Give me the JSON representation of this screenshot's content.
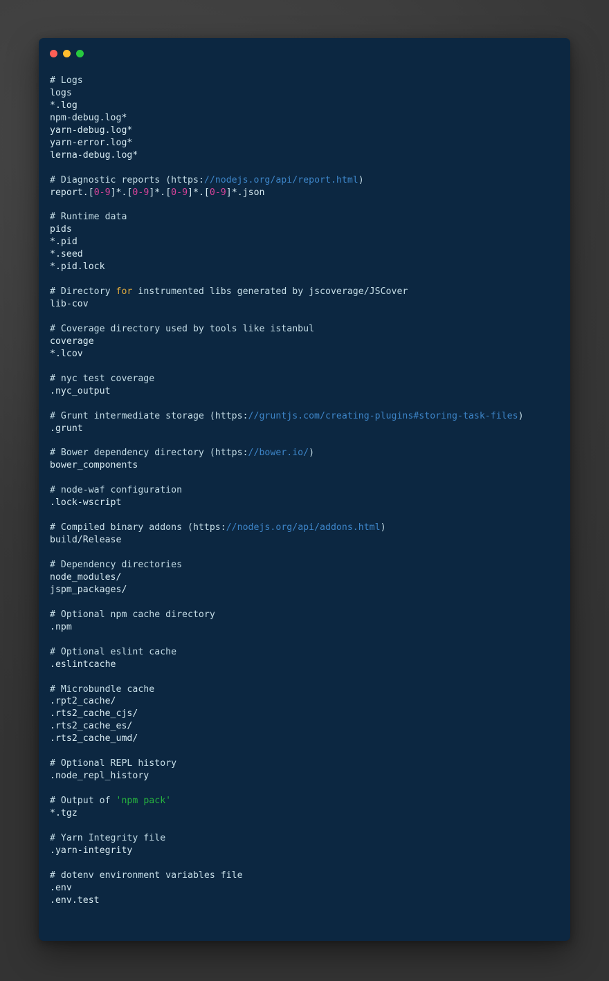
{
  "window": {
    "title": "",
    "background_color": "#0c2741",
    "page_background_color": "#3a3a3a",
    "traffic_lights": [
      {
        "name": "close",
        "color": "#ff5f56"
      },
      {
        "name": "minimize",
        "color": "#ffbd2e"
      },
      {
        "name": "zoom",
        "color": "#27c93f"
      }
    ]
  },
  "theme": {
    "text_color": "#d6e9f0",
    "comment_color": "#c5dde6",
    "url_color": "#3d85c8",
    "number_color": "#d9439a",
    "keyword_color": "#e0aa3e",
    "string_color": "#27b33f"
  },
  "code": {
    "language": "gitignore",
    "lines": [
      [
        {
          "t": "# Logs",
          "c": "cm"
        }
      ],
      [
        {
          "t": "logs",
          "c": "pl"
        }
      ],
      [
        {
          "t": "*.log",
          "c": "pl"
        }
      ],
      [
        {
          "t": "npm-debug.log*",
          "c": "pl"
        }
      ],
      [
        {
          "t": "yarn-debug.log*",
          "c": "pl"
        }
      ],
      [
        {
          "t": "yarn-error.log*",
          "c": "pl"
        }
      ],
      [
        {
          "t": "lerna-debug.log*",
          "c": "pl"
        }
      ],
      [],
      [
        {
          "t": "# Diagnostic reports (https:",
          "c": "cm"
        },
        {
          "t": "//nodejs.org/api/report.html",
          "c": "url"
        },
        {
          "t": ")",
          "c": "cm"
        }
      ],
      [
        {
          "t": "report.[",
          "c": "pl"
        },
        {
          "t": "0-9",
          "c": "num"
        },
        {
          "t": "]*.[",
          "c": "pl"
        },
        {
          "t": "0-9",
          "c": "num"
        },
        {
          "t": "]*.[",
          "c": "pl"
        },
        {
          "t": "0-9",
          "c": "num"
        },
        {
          "t": "]*.[",
          "c": "pl"
        },
        {
          "t": "0-9",
          "c": "num"
        },
        {
          "t": "]*.json",
          "c": "pl"
        }
      ],
      [],
      [
        {
          "t": "# Runtime data",
          "c": "cm"
        }
      ],
      [
        {
          "t": "pids",
          "c": "pl"
        }
      ],
      [
        {
          "t": "*.pid",
          "c": "pl"
        }
      ],
      [
        {
          "t": "*.seed",
          "c": "pl"
        }
      ],
      [
        {
          "t": "*.pid.lock",
          "c": "pl"
        }
      ],
      [],
      [
        {
          "t": "# Directory ",
          "c": "cm"
        },
        {
          "t": "for",
          "c": "kw"
        },
        {
          "t": " instrumented libs generated by jscoverage/JSCover",
          "c": "cm"
        }
      ],
      [
        {
          "t": "lib-cov",
          "c": "pl"
        }
      ],
      [],
      [
        {
          "t": "# Coverage directory used by tools like istanbul",
          "c": "cm"
        }
      ],
      [
        {
          "t": "coverage",
          "c": "pl"
        }
      ],
      [
        {
          "t": "*.lcov",
          "c": "pl"
        }
      ],
      [],
      [
        {
          "t": "# nyc test coverage",
          "c": "cm"
        }
      ],
      [
        {
          "t": ".nyc_output",
          "c": "pl"
        }
      ],
      [],
      [
        {
          "t": "# Grunt intermediate storage (https:",
          "c": "cm"
        },
        {
          "t": "//gruntjs.com/creating-plugins#storing-task-files",
          "c": "url"
        },
        {
          "t": ")",
          "c": "cm"
        }
      ],
      [
        {
          "t": ".grunt",
          "c": "pl"
        }
      ],
      [],
      [
        {
          "t": "# Bower dependency directory (https:",
          "c": "cm"
        },
        {
          "t": "//bower.io/",
          "c": "url"
        },
        {
          "t": ")",
          "c": "cm"
        }
      ],
      [
        {
          "t": "bower_components",
          "c": "pl"
        }
      ],
      [],
      [
        {
          "t": "# node-waf configuration",
          "c": "cm"
        }
      ],
      [
        {
          "t": ".lock-wscript",
          "c": "pl"
        }
      ],
      [],
      [
        {
          "t": "# Compiled binary addons (https:",
          "c": "cm"
        },
        {
          "t": "//nodejs.org/api/addons.html",
          "c": "url"
        },
        {
          "t": ")",
          "c": "cm"
        }
      ],
      [
        {
          "t": "build/Release",
          "c": "pl"
        }
      ],
      [],
      [
        {
          "t": "# Dependency directories",
          "c": "cm"
        }
      ],
      [
        {
          "t": "node_modules/",
          "c": "pl"
        }
      ],
      [
        {
          "t": "jspm_packages/",
          "c": "pl"
        }
      ],
      [],
      [
        {
          "t": "# Optional npm cache directory",
          "c": "cm"
        }
      ],
      [
        {
          "t": ".npm",
          "c": "pl"
        }
      ],
      [],
      [
        {
          "t": "# Optional eslint cache",
          "c": "cm"
        }
      ],
      [
        {
          "t": ".eslintcache",
          "c": "pl"
        }
      ],
      [],
      [
        {
          "t": "# Microbundle cache",
          "c": "cm"
        }
      ],
      [
        {
          "t": ".rpt2_cache/",
          "c": "pl"
        }
      ],
      [
        {
          "t": ".rts2_cache_cjs/",
          "c": "pl"
        }
      ],
      [
        {
          "t": ".rts2_cache_es/",
          "c": "pl"
        }
      ],
      [
        {
          "t": ".rts2_cache_umd/",
          "c": "pl"
        }
      ],
      [],
      [
        {
          "t": "# Optional REPL history",
          "c": "cm"
        }
      ],
      [
        {
          "t": ".node_repl_history",
          "c": "pl"
        }
      ],
      [],
      [
        {
          "t": "# Output of ",
          "c": "cm"
        },
        {
          "t": "'npm pack'",
          "c": "str"
        }
      ],
      [
        {
          "t": "*.tgz",
          "c": "pl"
        }
      ],
      [],
      [
        {
          "t": "# Yarn Integrity file",
          "c": "cm"
        }
      ],
      [
        {
          "t": ".yarn-integrity",
          "c": "pl"
        }
      ],
      [],
      [
        {
          "t": "# dotenv environment variables file",
          "c": "cm"
        }
      ],
      [
        {
          "t": ".env",
          "c": "pl"
        }
      ],
      [
        {
          "t": ".env.test",
          "c": "pl"
        }
      ]
    ]
  }
}
